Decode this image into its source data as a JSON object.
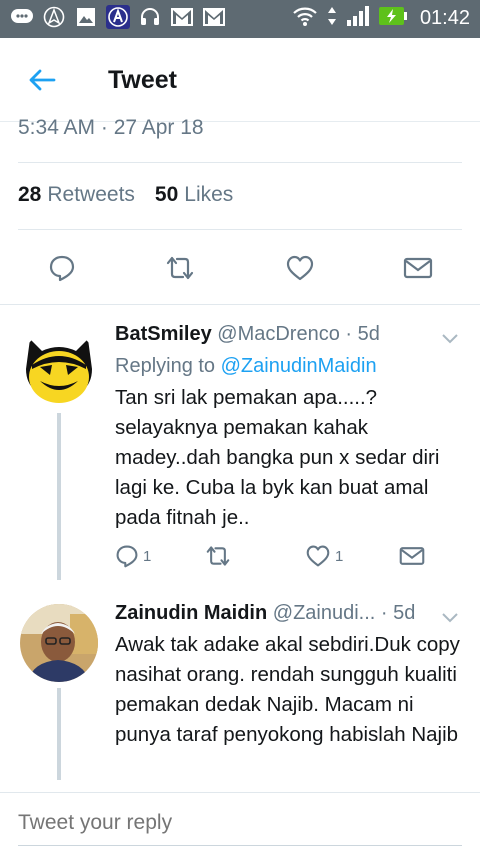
{
  "status_bar": {
    "time": "01:42",
    "icons_left": [
      "chat-icon",
      "navigation-icon",
      "image-icon",
      "app-a-icon",
      "headset-icon",
      "gmail-icon",
      "gmail-icon"
    ],
    "icons_right": [
      "wifi-icon",
      "data-arrows-icon",
      "signal-icon",
      "battery-charging-icon"
    ]
  },
  "header": {
    "title": "Tweet"
  },
  "tweet": {
    "timestamp": "5:34 AM · 27 Apr 18",
    "retweets_count": "28",
    "retweets_label": "Retweets",
    "likes_count": "50",
    "likes_label": "Likes"
  },
  "replies": [
    {
      "name": "BatSmiley",
      "handle": "@MacDrenco",
      "age": "· 5d",
      "replying_prefix": "Replying to",
      "replying_to": "@ZainudinMaidin",
      "text": "Tan sri lak pemakan apa.....? selayaknya pemakan kahak madey..dah bangka pun x sedar diri lagi ke. Cuba la byk kan buat amal pada fitnah je..",
      "reply_count": "1",
      "like_count": "1"
    },
    {
      "name": "Zainudin Maidin",
      "handle": "@Zainudi...",
      "age": "· 5d",
      "text": "Awak tak adake akal sebdiri.Duk copy nasihat orang. rendah sungguh kualiti pemakan dedak Najib. Macam ni punya taraf penyokong habislah Najib"
    }
  ],
  "compose": {
    "placeholder": "Tweet your reply"
  },
  "colors": {
    "accent": "#1da1f2",
    "secondary_text": "#657786",
    "status_bar": "#5e6a72"
  }
}
